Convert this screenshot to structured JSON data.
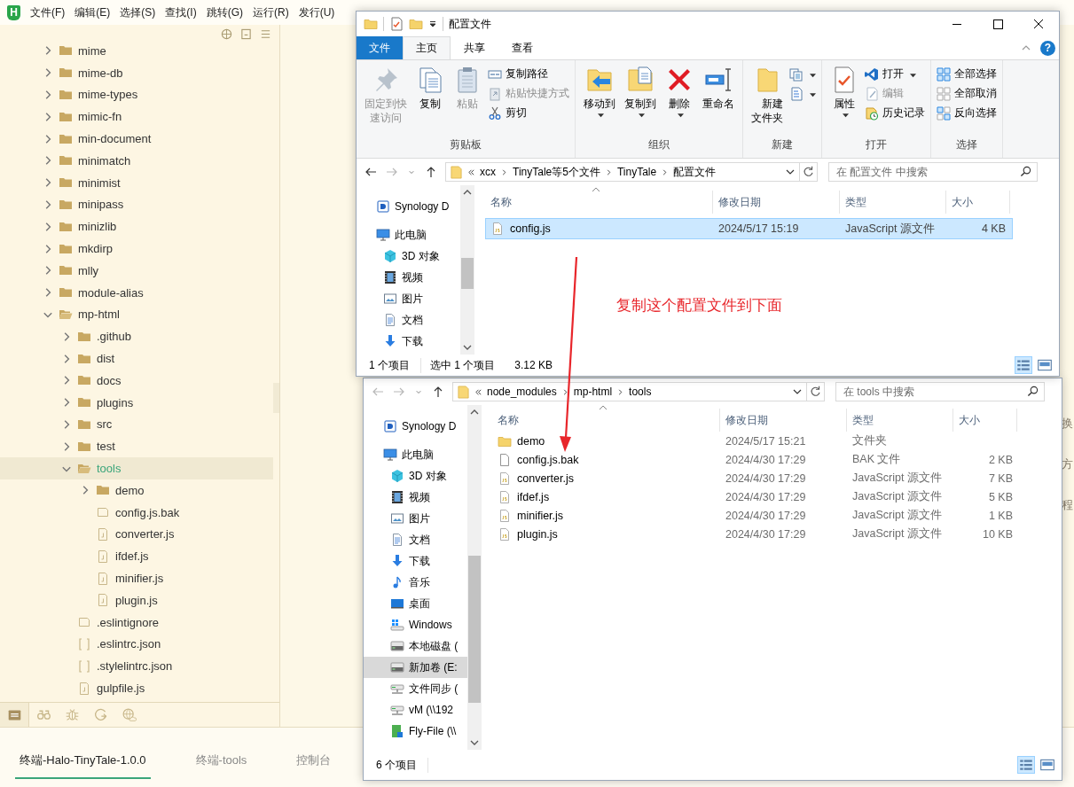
{
  "ide": {
    "logo": "H",
    "menu": [
      "文件(F)",
      "编辑(E)",
      "选择(S)",
      "查找(I)",
      "跳转(G)",
      "运行(R)",
      "发行(U)"
    ],
    "tree": [
      {
        "name": "mime",
        "kind": "folder",
        "expanded": false,
        "selected": false
      },
      {
        "name": "mime-db",
        "kind": "folder",
        "expanded": false,
        "selected": false
      },
      {
        "name": "mime-types",
        "kind": "folder",
        "expanded": false,
        "selected": false
      },
      {
        "name": "mimic-fn",
        "kind": "folder",
        "expanded": false,
        "selected": false
      },
      {
        "name": "min-document",
        "kind": "folder",
        "expanded": false,
        "selected": false
      },
      {
        "name": "minimatch",
        "kind": "folder",
        "expanded": false,
        "selected": false
      },
      {
        "name": "minimist",
        "kind": "folder",
        "expanded": false,
        "selected": false
      },
      {
        "name": "minipass",
        "kind": "folder",
        "expanded": false,
        "selected": false
      },
      {
        "name": "minizlib",
        "kind": "folder",
        "expanded": false,
        "selected": false
      },
      {
        "name": "mkdirp",
        "kind": "folder",
        "expanded": false,
        "selected": false
      },
      {
        "name": "mlly",
        "kind": "folder",
        "expanded": false,
        "selected": false
      },
      {
        "name": "module-alias",
        "kind": "folder",
        "expanded": false,
        "selected": false
      },
      {
        "name": "mp-html",
        "kind": "folder",
        "expanded": true,
        "selected": false,
        "children": [
          {
            "name": ".github",
            "kind": "folder",
            "expanded": false,
            "selected": false
          },
          {
            "name": "dist",
            "kind": "folder",
            "expanded": false,
            "selected": false
          },
          {
            "name": "docs",
            "kind": "folder",
            "expanded": false,
            "selected": false
          },
          {
            "name": "plugins",
            "kind": "folder",
            "expanded": false,
            "selected": false
          },
          {
            "name": "src",
            "kind": "folder",
            "expanded": false,
            "selected": false
          },
          {
            "name": "test",
            "kind": "folder",
            "expanded": false,
            "selected": false
          },
          {
            "name": "tools",
            "kind": "folder",
            "expanded": true,
            "selected": true,
            "children": [
              {
                "name": "demo",
                "kind": "folder",
                "expanded": false,
                "selected": false
              },
              {
                "name": "config.js.bak",
                "kind": "blank",
                "selected": false
              },
              {
                "name": "converter.js",
                "kind": "js",
                "selected": false
              },
              {
                "name": "ifdef.js",
                "kind": "js",
                "selected": false
              },
              {
                "name": "minifier.js",
                "kind": "js",
                "selected": false
              },
              {
                "name": "plugin.js",
                "kind": "js",
                "selected": false
              }
            ]
          },
          {
            "name": ".eslintignore",
            "kind": "blank",
            "selected": false
          },
          {
            "name": ".eslintrc.json",
            "kind": "json",
            "selected": false
          },
          {
            "name": ".stylelintrc.json",
            "kind": "json",
            "selected": false
          },
          {
            "name": "gulpfile.js",
            "kind": "js",
            "selected": false
          }
        ]
      }
    ],
    "panels": [
      {
        "kind": "files",
        "selected": true
      },
      {
        "kind": "search",
        "selected": false
      },
      {
        "kind": "debug",
        "selected": false
      },
      {
        "kind": "sync",
        "selected": false
      },
      {
        "kind": "globe",
        "selected": false
      }
    ],
    "terminal_tabs": [
      {
        "label": "终端-Halo-TinyTale-1.0.0",
        "selected": true
      },
      {
        "label": "终端-tools",
        "selected": false
      },
      {
        "label": "控制台",
        "selected": false
      }
    ],
    "editor_fragments": [
      "换",
      "方",
      "程"
    ]
  },
  "explorers": [
    {
      "title": "配置文件",
      "help_label": "?",
      "tabs": [
        {
          "label": "文件",
          "kind": "file",
          "selected": false
        },
        {
          "label": "主页",
          "kind": "tab",
          "selected": true
        },
        {
          "label": "共享",
          "kind": "tab",
          "selected": false
        },
        {
          "label": "查看",
          "kind": "tab",
          "selected": false
        }
      ],
      "ribbon": [
        {
          "label": "剪贴板",
          "items": [
            {
              "label": "固定到快速访问",
              "kind": "pin",
              "disabled": true,
              "dropdown": false
            },
            {
              "label": "复制",
              "kind": "copy",
              "disabled": false,
              "dropdown": false
            },
            {
              "label": "粘贴",
              "kind": "paste",
              "disabled": true,
              "dropdown": false
            },
            {
              "label": "复制路径",
              "kind": "copy-path",
              "disabled": false,
              "dropdown": false
            },
            {
              "label": "粘贴快捷方式",
              "kind": "paste-shortcut",
              "disabled": true,
              "dropdown": false
            },
            {
              "label": "剪切",
              "kind": "cut",
              "disabled": false,
              "dropdown": false
            }
          ]
        },
        {
          "label": "组织",
          "items": [
            {
              "label": "移动到",
              "kind": "move-to",
              "disabled": false,
              "dropdown": true
            },
            {
              "label": "复制到",
              "kind": "copy-to",
              "disabled": false,
              "dropdown": true
            },
            {
              "label": "删除",
              "kind": "delete",
              "disabled": false,
              "dropdown": true
            },
            {
              "label": "重命名",
              "kind": "rename",
              "disabled": false,
              "dropdown": false
            }
          ]
        },
        {
          "label": "新建",
          "items": [
            {
              "label": "新建文件夹",
              "kind": "new-folder",
              "disabled": false,
              "dropdown": false
            },
            {
              "kind": "new-item",
              "disabled": false,
              "dropdown": true
            },
            {
              "kind": "easy-access",
              "disabled": false,
              "dropdown": true
            }
          ]
        },
        {
          "label": "打开",
          "items": [
            {
              "label": "属性",
              "kind": "properties",
              "disabled": false,
              "dropdown": true
            },
            {
              "label": "打开",
              "kind": "open",
              "disabled": false,
              "dropdown": true
            },
            {
              "label": "编辑",
              "kind": "edit",
              "disabled": true,
              "dropdown": false
            },
            {
              "label": "历史记录",
              "kind": "history",
              "disabled": false,
              "dropdown": false
            }
          ]
        },
        {
          "label": "选择",
          "items": [
            {
              "label": "全部选择",
              "kind": "select-all",
              "disabled": false,
              "dropdown": false
            },
            {
              "label": "全部取消",
              "kind": "select-none",
              "disabled": false,
              "dropdown": false
            },
            {
              "label": "反向选择",
              "kind": "invert-selection",
              "disabled": false,
              "dropdown": false
            }
          ]
        }
      ],
      "nav": [
        {
          "kind": "back",
          "disabled": false
        },
        {
          "kind": "forward",
          "disabled": true
        },
        {
          "kind": "recent",
          "disabled": false
        },
        {
          "kind": "up",
          "disabled": false
        }
      ],
      "address": [
        "xcx",
        "TinyTale等5个文件",
        "TinyTale",
        "配置文件"
      ],
      "search": {
        "placeholder": "在 配置文件 中搜索"
      },
      "nav_pane": [
        {
          "label": "Synology D",
          "kind": "nas",
          "selected": false
        },
        {
          "label": "此电脑",
          "kind": "pc",
          "selected": false,
          "children": [
            {
              "label": "3D 对象",
              "kind": "cube",
              "selected": false
            },
            {
              "label": "视频",
              "kind": "video",
              "selected": false
            },
            {
              "label": "图片",
              "kind": "pictures",
              "selected": false
            },
            {
              "label": "文档",
              "kind": "documents",
              "selected": false
            },
            {
              "label": "下载",
              "kind": "downloads",
              "selected": false
            }
          ]
        }
      ],
      "columns": [
        "名称",
        "修改日期",
        "类型",
        "大小"
      ],
      "rows": [
        {
          "name": "config.js",
          "kind": "js",
          "date": "2024/5/17 15:19",
          "type": "JavaScript 源文件",
          "size": "4 KB",
          "selected": true
        }
      ],
      "status": [
        "1 个项目",
        "选中 1 个项目",
        "3.12 KB"
      ],
      "views": [
        {
          "kind": "details",
          "selected": true
        },
        {
          "kind": "tiles",
          "selected": false
        }
      ]
    },
    {
      "nav": [
        {
          "kind": "back",
          "disabled": true
        },
        {
          "kind": "forward",
          "disabled": true
        },
        {
          "kind": "recent",
          "disabled": false
        },
        {
          "kind": "up",
          "disabled": false
        }
      ],
      "address": [
        "node_modules",
        "mp-html",
        "tools"
      ],
      "search": {
        "placeholder": "在 tools 中搜索"
      },
      "nav_pane": [
        {
          "label": "Synology D",
          "kind": "nas",
          "selected": false
        },
        {
          "label": "此电脑",
          "kind": "pc",
          "selected": false,
          "children": [
            {
              "label": "3D 对象",
              "kind": "cube",
              "selected": false
            },
            {
              "label": "视频",
              "kind": "video",
              "selected": false
            },
            {
              "label": "图片",
              "kind": "pictures",
              "selected": false
            },
            {
              "label": "文档",
              "kind": "documents",
              "selected": false
            },
            {
              "label": "下载",
              "kind": "downloads",
              "selected": false
            },
            {
              "label": "音乐",
              "kind": "music",
              "selected": false
            },
            {
              "label": "桌面",
              "kind": "desktop",
              "selected": false
            },
            {
              "label": "Windows",
              "kind": "windows-drive",
              "selected": false
            },
            {
              "label": "本地磁盘 (",
              "kind": "drive",
              "selected": false
            },
            {
              "label": "新加卷 (E:",
              "kind": "drive",
              "selected": true
            },
            {
              "label": "文件同步 (",
              "kind": "network-drive",
              "selected": false
            },
            {
              "label": "vM (\\\\192",
              "kind": "network-drive",
              "selected": false
            },
            {
              "label": "Fly-File (\\\\",
              "kind": "fly-file",
              "selected": false
            }
          ]
        }
      ],
      "columns": [
        "名称",
        "修改日期",
        "类型",
        "大小"
      ],
      "rows": [
        {
          "name": "demo",
          "kind": "folder",
          "date": "2024/5/17 15:21",
          "type": "文件夹",
          "size": "",
          "selected": false
        },
        {
          "name": "config.js.bak",
          "kind": "blank",
          "date": "2024/4/30 17:29",
          "type": "BAK 文件",
          "size": "2 KB",
          "selected": false
        },
        {
          "name": "converter.js",
          "kind": "js",
          "date": "2024/4/30 17:29",
          "type": "JavaScript 源文件",
          "size": "7 KB",
          "selected": false
        },
        {
          "name": "ifdef.js",
          "kind": "js",
          "date": "2024/4/30 17:29",
          "type": "JavaScript 源文件",
          "size": "5 KB",
          "selected": false
        },
        {
          "name": "minifier.js",
          "kind": "js",
          "date": "2024/4/30 17:29",
          "type": "JavaScript 源文件",
          "size": "1 KB",
          "selected": false
        },
        {
          "name": "plugin.js",
          "kind": "js",
          "date": "2024/4/30 17:29",
          "type": "JavaScript 源文件",
          "size": "10 KB",
          "selected": false
        }
      ],
      "status": [
        "6 个项目"
      ],
      "views": [
        {
          "kind": "details",
          "selected": true
        },
        {
          "kind": "tiles",
          "selected": false
        }
      ]
    }
  ],
  "annotation": {
    "text": "复制这个配置文件到下面"
  }
}
